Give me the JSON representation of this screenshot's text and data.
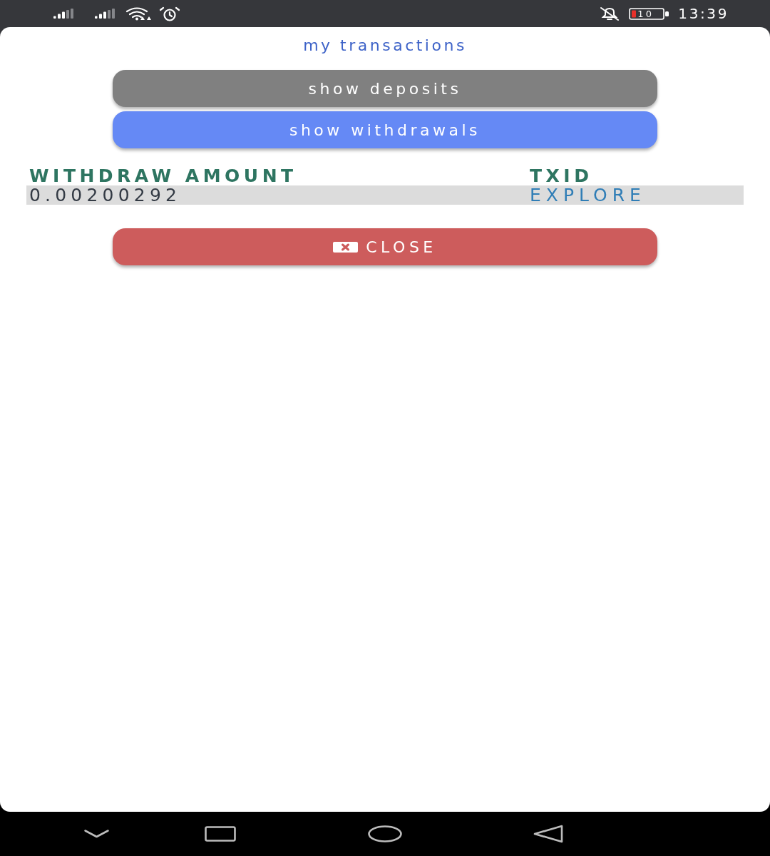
{
  "status_bar": {
    "battery": "10",
    "time": "13:39"
  },
  "dialog": {
    "title": "my transactions",
    "filters": [
      {
        "label": "show deposits",
        "selected": false
      },
      {
        "label": "show withdrawals",
        "selected": true
      }
    ],
    "table": {
      "columns": [
        "WITHDRAW AMOUNT",
        "TXID"
      ],
      "rows": [
        {
          "amount": "0.00200292",
          "txid": "EXPLORE",
          "shaded": true
        }
      ]
    },
    "close_button": {
      "label": "CLOSE"
    }
  }
}
